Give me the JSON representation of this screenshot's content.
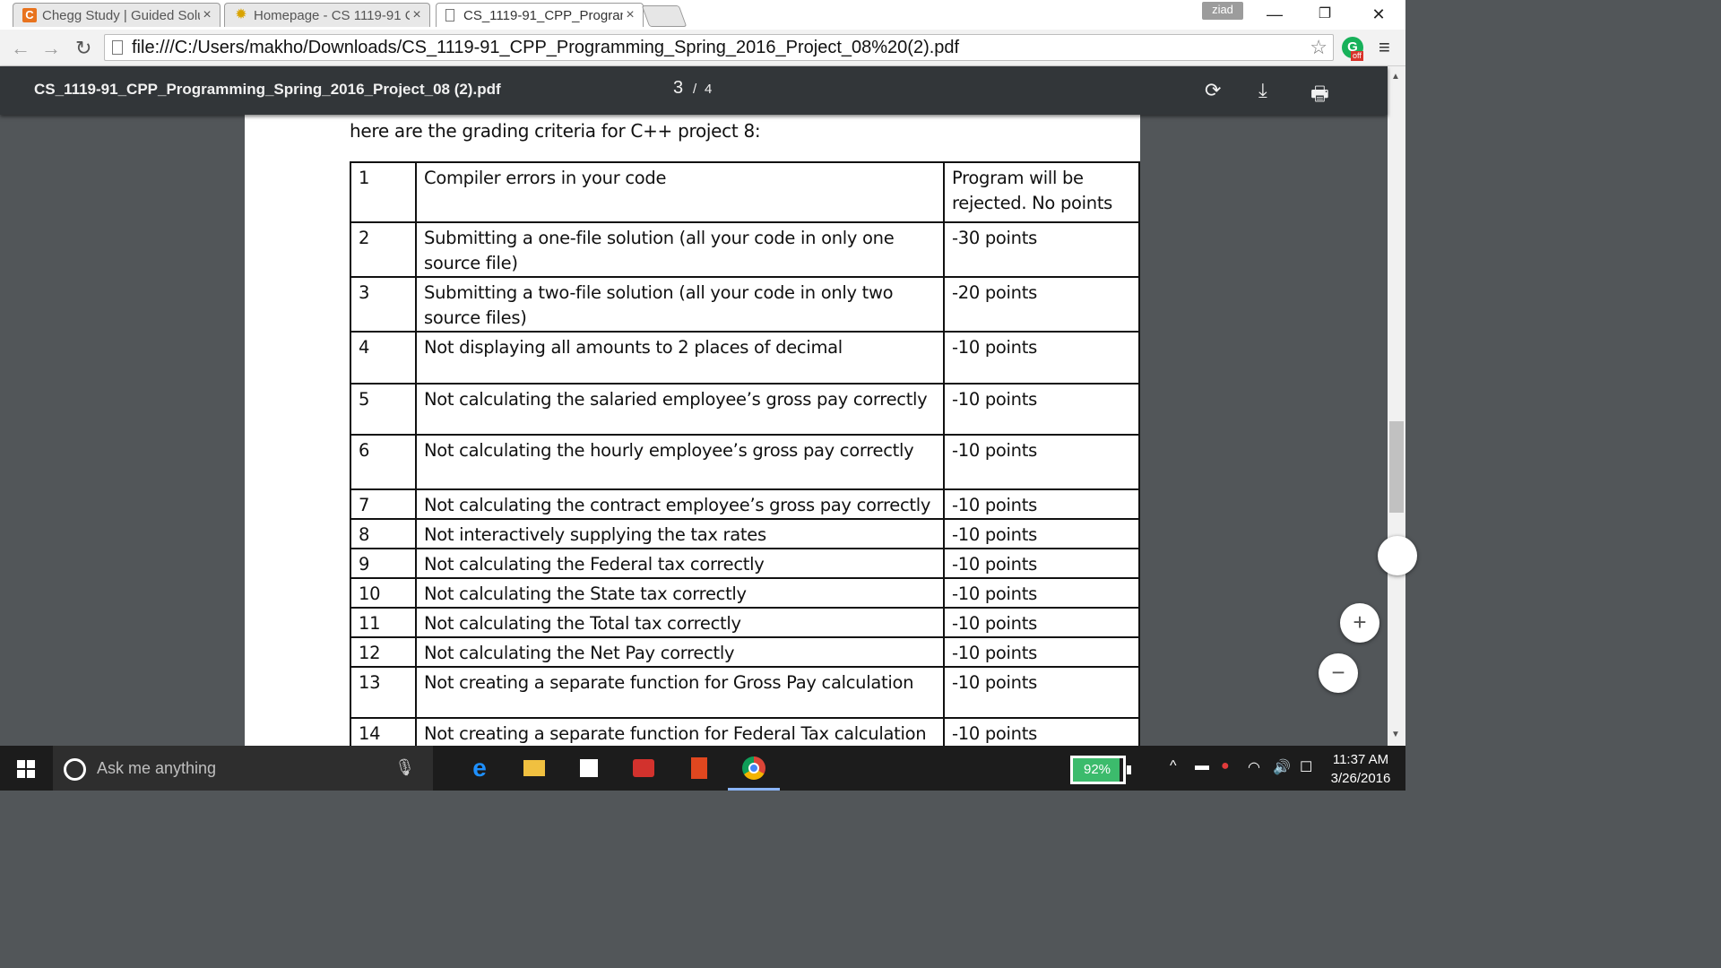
{
  "tabs": [
    {
      "label": "Chegg Study | Guided Solu",
      "close": "×",
      "icon": "chegg-icon"
    },
    {
      "label": "Homepage - CS 1119-91 C",
      "close": "×",
      "icon": "sun-icon"
    },
    {
      "label": "CS_1119-91_CPP_Programm",
      "close": "×",
      "icon": "page-icon"
    }
  ],
  "profile_label": "ziad",
  "window_controls": {
    "minimize": "—",
    "restore": "❐",
    "close": "✕"
  },
  "toolbar": {
    "back": "←",
    "forward": "→",
    "reload": "↻",
    "url": "file:///C:/Users/makho/Downloads/CS_1119-91_CPP_Programming_Spring_2016_Project_08%20(2).pdf",
    "star": "☆",
    "extension_letter": "G",
    "extension_badge": "off",
    "menu": "≡"
  },
  "pdf": {
    "filename": "CS_1119-91_CPP_Programming_Spring_2016_Project_08 (2).pdf",
    "current_page": "3",
    "separator": "/",
    "total_pages": "4",
    "rotate_icon": "⟳",
    "download_icon": "⤓",
    "print_icon": "🖶"
  },
  "document": {
    "intro": "here are the grading criteria for C++ project 8:",
    "rows": [
      {
        "num": "1",
        "criterion": "Compiler errors in your code",
        "penalty": "Program will be rejected. No points"
      },
      {
        "num": "2",
        "criterion": "Submitting a one-file solution (all your code in only one source file)",
        "penalty": "-30 points"
      },
      {
        "num": "3",
        "criterion": "Submitting a two-file solution (all your code in only two source files)",
        "penalty": "-20 points"
      },
      {
        "num": "4",
        "criterion": "Not displaying all amounts to 2 places of decimal",
        "penalty": "-10 points"
      },
      {
        "num": "5",
        "criterion": "Not calculating the salaried employee’s gross pay correctly",
        "penalty": "-10 points"
      },
      {
        "num": "6",
        "criterion": "Not calculating the hourly employee’s gross pay correctly",
        "penalty": "-10 points"
      },
      {
        "num": "7",
        "criterion": "Not calculating the contract employee’s gross pay correctly",
        "penalty": "-10 points"
      },
      {
        "num": "8",
        "criterion": "Not interactively supplying the tax rates",
        "penalty": "-10 points"
      },
      {
        "num": "9",
        "criterion": "Not calculating the Federal tax correctly",
        "penalty": "-10 points"
      },
      {
        "num": "10",
        "criterion": "Not calculating the State tax correctly",
        "penalty": "-10 points"
      },
      {
        "num": "11",
        "criterion": "Not calculating the Total tax correctly",
        "penalty": "-10 points"
      },
      {
        "num": "12",
        "criterion": "Not calculating the Net Pay correctly",
        "penalty": "-10 points"
      },
      {
        "num": "13",
        "criterion": "Not creating a separate function for Gross Pay calculation",
        "penalty": "-10 points"
      },
      {
        "num": "14",
        "criterion": "Not creating a separate function for Federal Tax calculation",
        "penalty": "-10 points"
      }
    ]
  },
  "zoom": {
    "in": "+",
    "out": "−"
  },
  "taskbar": {
    "search_placeholder": "Ask me anything",
    "battery_percent": "92%",
    "battery_level": 0.92,
    "time": "11:37 AM",
    "date": "3/26/2016",
    "tray_up": "^",
    "colors": {
      "battery": "#3cbb6c",
      "taskbar": "#1c1c1c"
    }
  }
}
